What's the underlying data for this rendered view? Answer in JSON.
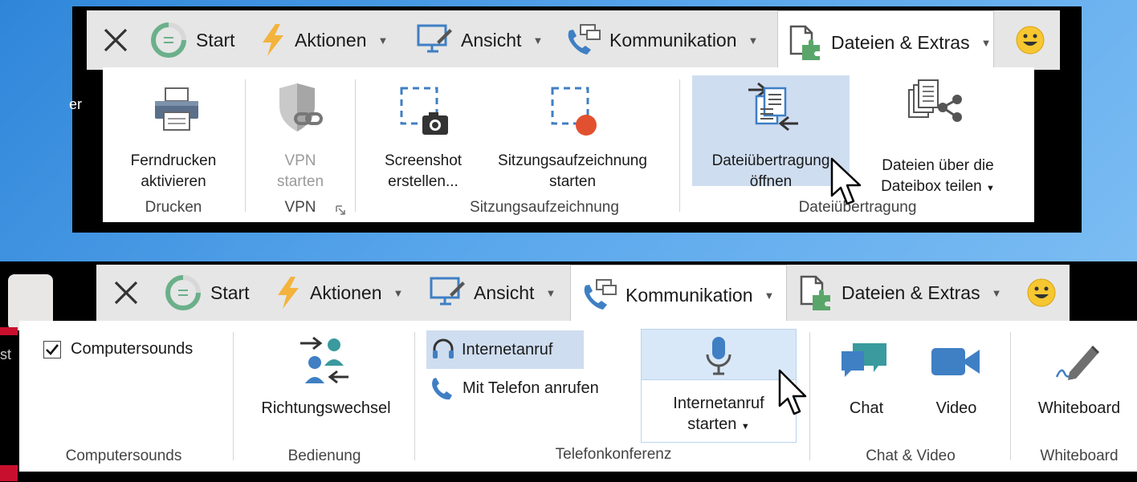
{
  "top": {
    "tabs": {
      "start": "Start",
      "aktionen": "Aktionen",
      "ansicht": "Ansicht",
      "kommunikation": "Kommunikation",
      "dateien": "Dateien & Extras"
    },
    "buttons": {
      "ferndrucken": [
        "Ferndrucken",
        "aktivieren"
      ],
      "vpn": [
        "VPN",
        "starten"
      ],
      "screenshot": [
        "Screenshot",
        "erstellen..."
      ],
      "sitzung": [
        "Sitzungsaufzeichnung",
        "starten"
      ],
      "dateiuebertragung": [
        "Dateiübertragung",
        "öffnen"
      ],
      "dateibox": [
        "Dateien über die",
        "Dateibox teilen"
      ]
    },
    "groups": {
      "drucken": "Drucken",
      "vpn": "VPN",
      "sitzungsaufzeichnung": "Sitzungsaufzeichnung",
      "dateiuebertragung": "Dateiübertragung"
    },
    "side_text": "er"
  },
  "bottom": {
    "tabs": {
      "start": "Start",
      "aktionen": "Aktionen",
      "ansicht": "Ansicht",
      "kommunikation": "Kommunikation",
      "dateien": "Dateien & Extras"
    },
    "buttons": {
      "computersounds": "Computersounds",
      "richtungswechsel": "Richtungswechsel",
      "internetanruf": "Internetanruf",
      "telefon": "Mit Telefon anrufen",
      "internetanruf_starten": [
        "Internetanruf",
        "starten"
      ],
      "chat": "Chat",
      "video": "Video",
      "whiteboard": "Whiteboard"
    },
    "groups": {
      "computersounds": "Computersounds",
      "bedienung": "Bedienung",
      "telefonkonferenz": "Telefonkonferenz",
      "chat_video": "Chat & Video",
      "whiteboard": "Whiteboard"
    },
    "side_text": "st",
    "computersounds_checked": true
  },
  "colors": {
    "accent_blue": "#3f7fc4",
    "highlight": "#cfddf0",
    "chat_teal": "#3a9a9e",
    "record_red": "#e2512f"
  }
}
